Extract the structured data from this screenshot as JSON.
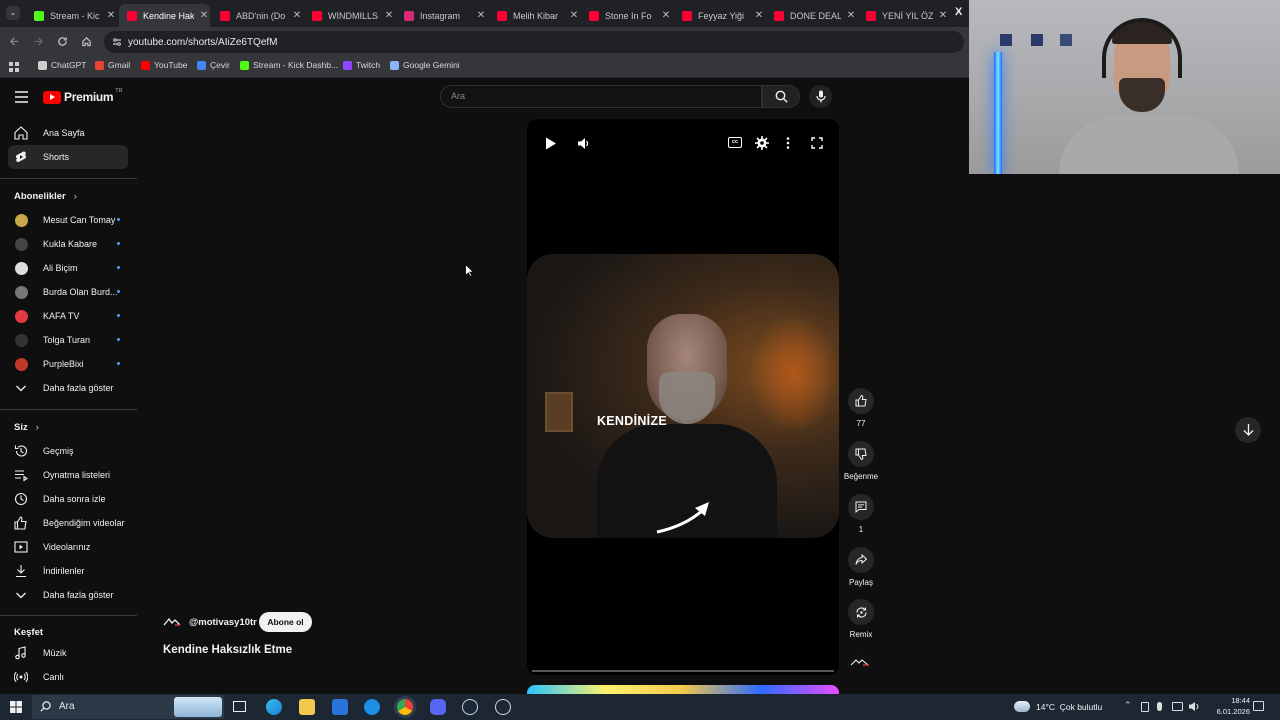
{
  "browser": {
    "tabs": [
      {
        "title": "Stream - Kic",
        "color": "#53fc18"
      },
      {
        "title": "Kendine Hak",
        "color": "#ff0033",
        "active": true
      },
      {
        "title": "ABD'nin (Do",
        "color": "#ff0033"
      },
      {
        "title": "WINDMILLS",
        "color": "#ff0033"
      },
      {
        "title": "Instagram",
        "color": "#d62976"
      },
      {
        "title": "Melih Kibar",
        "color": "#ff0033"
      },
      {
        "title": "Stone In Fo",
        "color": "#ff0033"
      },
      {
        "title": "Feyyaz Yiği",
        "color": "#ff0033"
      },
      {
        "title": "DONE DEAL",
        "color": "#ff0033"
      },
      {
        "title": "YENİ YIL ÖZ",
        "color": "#ff0033"
      }
    ],
    "tab_close": "✕",
    "url": "youtube.com/shorts/AIiZe6TQefM",
    "bookmarks": [
      {
        "label": "ChatGPT",
        "color": "#cfcfcf"
      },
      {
        "label": "Gmail",
        "color": "#ea4335"
      },
      {
        "label": "YouTube",
        "color": "#ff0000"
      },
      {
        "label": "Çevir",
        "color": "#4285f4"
      },
      {
        "label": "Stream - Kick Dashb...",
        "color": "#53fc18"
      },
      {
        "label": "Twitch",
        "color": "#9146ff"
      },
      {
        "label": "Google Gemini",
        "color": "#8ab4f8"
      }
    ]
  },
  "yt": {
    "logo": "Premium",
    "logo_sup": "TR",
    "search_placeholder": "Ara",
    "nav": [
      {
        "label": "Ana Sayfa",
        "icon": "home-icon"
      },
      {
        "label": "Shorts",
        "icon": "shorts-icon",
        "active": true
      }
    ],
    "subs_title": "Abonelikler",
    "subs": [
      {
        "label": "Mesut Can Tomay",
        "color": "#c9a64a"
      },
      {
        "label": "Kukla Kabare",
        "color": "#444"
      },
      {
        "label": "Ali Biçim",
        "color": "#dddddd"
      },
      {
        "label": "Burda Olan Burd...",
        "color": "#777"
      },
      {
        "label": "KAFA TV",
        "color": "#e53945"
      },
      {
        "label": "Tolga Turan",
        "color": "#333"
      },
      {
        "label": "PurpleBixi",
        "color": "#c0392b"
      }
    ],
    "show_more": "Daha fazla göster",
    "you_title": "Siz",
    "you_items": [
      {
        "label": "Geçmiş",
        "icon": "history-icon"
      },
      {
        "label": "Oynatma listeleri",
        "icon": "playlists-icon"
      },
      {
        "label": "Daha sonra izle",
        "icon": "watch-later-icon"
      },
      {
        "label": "Beğendiğim videolar",
        "icon": "liked-videos-icon"
      },
      {
        "label": "Videolarınız",
        "icon": "your-videos-icon"
      },
      {
        "label": "İndirilenler",
        "icon": "downloads-icon"
      }
    ],
    "show_more_2": "Daha fazla göster",
    "explore_title": "Keşfet",
    "explore_items": [
      {
        "label": "Müzik",
        "icon": "music-icon"
      },
      {
        "label": "Canlı",
        "icon": "live-icon"
      }
    ]
  },
  "short": {
    "caption": "KENDİNİZE",
    "channel": "@motivasy10tr",
    "subscribe": "Abone ol",
    "title": "Kendine Haksızlık Etme",
    "likes": "77",
    "dislike_label": "Beğenme",
    "comments": "1",
    "share_label": "Paylaş",
    "remix_label": "Remix"
  },
  "taskbar": {
    "search": "Ara",
    "weather": "14°C  Çok bulutlu",
    "time": "18:44",
    "date": "6.01.2026"
  }
}
